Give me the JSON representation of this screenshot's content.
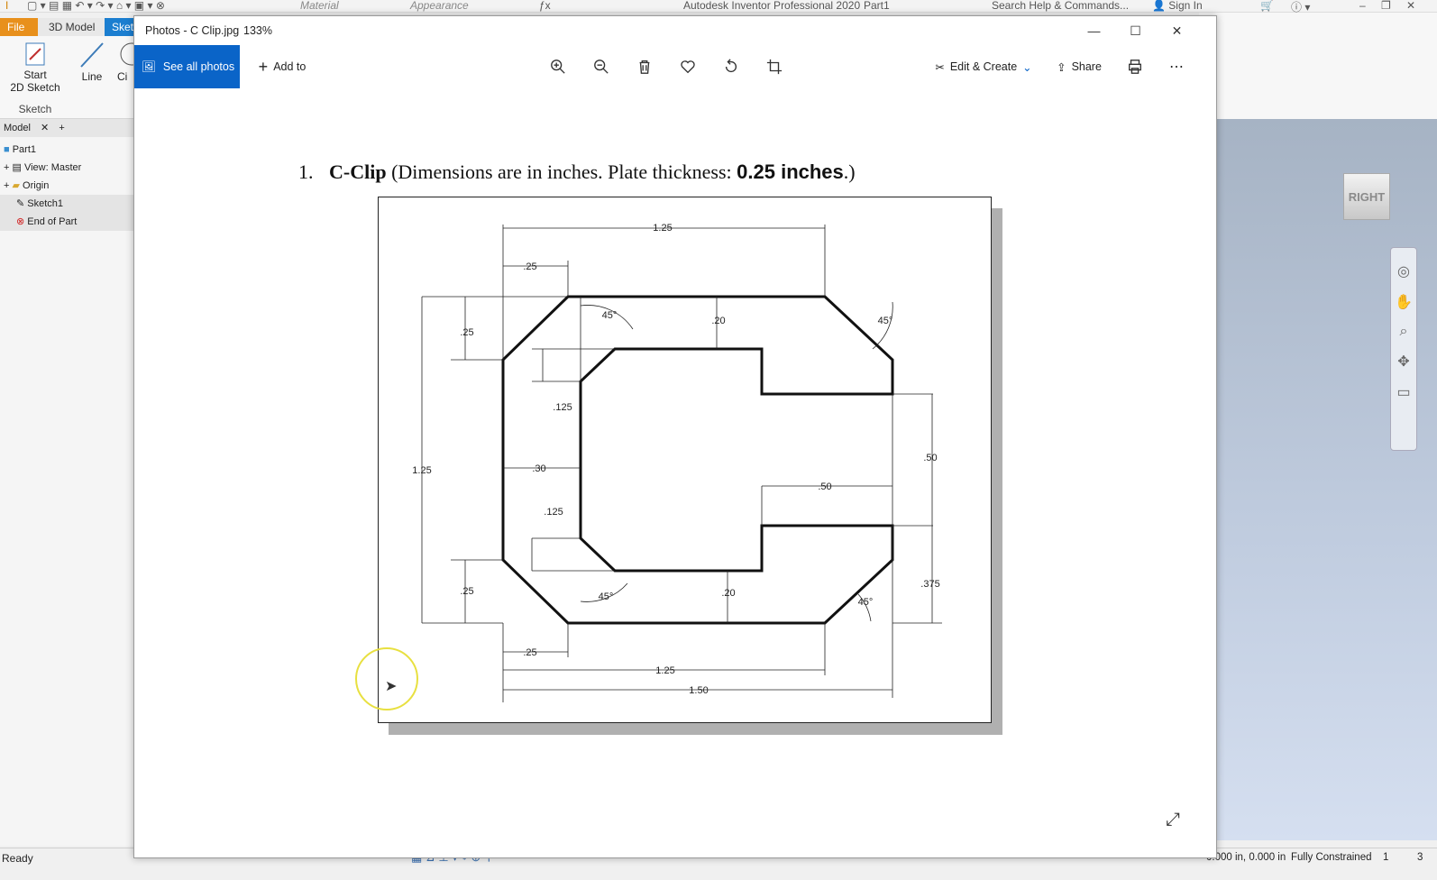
{
  "inventor": {
    "app_title": "Autodesk Inventor Professional 2020",
    "doc_name": "Part1",
    "material_label": "Material",
    "appearance_label": "Appearance",
    "search_placeholder": "Search Help & Commands...",
    "sign_in": "Sign In",
    "tabs": {
      "file": "File",
      "model3d": "3D Model",
      "sketch": "Sket"
    },
    "ribbon": {
      "start_sketch_l1": "Start",
      "start_sketch_l2": "2D Sketch",
      "line": "Line",
      "circle": "Ci",
      "group": "Sketch"
    },
    "browser": {
      "tab": "Model",
      "items": [
        "Part1",
        "View: Master",
        "Origin",
        "Sketch1",
        "End of Part"
      ]
    },
    "viewcube_label": "RIGHT",
    "status": {
      "left": "Ready",
      "coords": "0.000 in, 0.000 in",
      "constraint": "Fully Constrained",
      "n1": "1",
      "n2": "3"
    }
  },
  "photos": {
    "title": "Photos - C Clip.jpg",
    "zoom": "133%",
    "toolbar": {
      "see_all": "See all photos",
      "add_to": "Add to",
      "edit_create": "Edit & Create",
      "share": "Share"
    }
  },
  "document": {
    "heading_num": "1.",
    "heading_bold": "C-Clip",
    "heading_rest": " (Dimensions are in inches. Plate thickness: ",
    "heading_thick": "0.25 inches",
    "heading_end": ".)",
    "dims": {
      "top_width": "1.25",
      "top_chamfer": ".25",
      "left_height": "1.25",
      "top_left_v": ".25",
      "bot_left_v": ".25",
      "inner_125_top": ".125",
      "inner_125_bot": ".125",
      "wall_30": ".30",
      "top_20": ".20",
      "bot_20": ".20",
      "right_50": ".50",
      "right_375": ".375",
      "inner_50": ".50",
      "bot_chamfer": ".25",
      "bot_125": "1.25",
      "bot_150": "1.50",
      "ang_tl": "45°",
      "ang_tr": "45°",
      "ang_bl": "45°",
      "ang_br": "45°"
    }
  }
}
